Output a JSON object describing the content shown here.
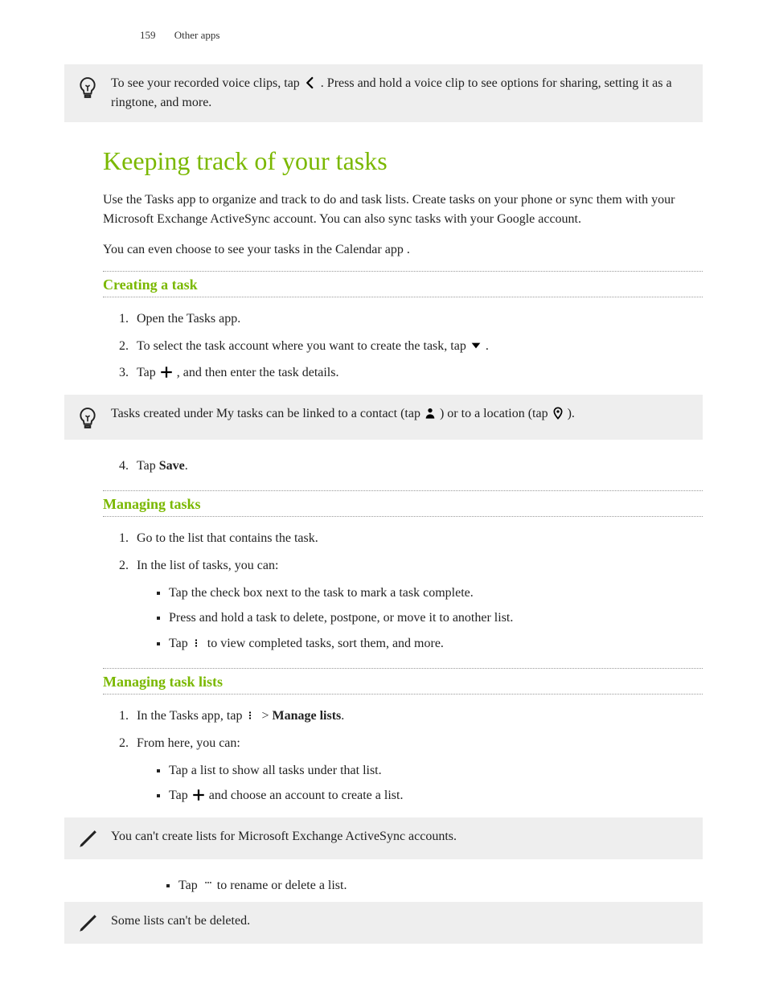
{
  "header": {
    "page_number": "159",
    "section": "Other apps"
  },
  "tip1": {
    "pre": "To see your recorded voice clips, tap ",
    "post": " . Press and hold a voice clip to see options for sharing, setting it as a ringtone, and more."
  },
  "main_heading": "Keeping track of your tasks",
  "intro_p1": "Use the Tasks app to organize and track to do and task lists. Create tasks on your phone or sync them with your Microsoft Exchange ActiveSync account. You can also sync tasks with your Google account.",
  "intro_p2": "You can even choose to see your tasks in the Calendar app .",
  "section_creating": {
    "heading": "Creating a task",
    "steps": {
      "s1": "Open the Tasks app.",
      "s2_pre": "To select the task account where you want to create the task, tap ",
      "s2_post": " .",
      "s3_pre": "Tap ",
      "s3_post": ", and then enter the task details.",
      "s4_pre": "Tap ",
      "s4_bold": "Save",
      "s4_post": "."
    },
    "tip": {
      "pre": "Tasks created under My tasks can be linked to a contact (tap ",
      "mid": " ) or to a location (tap ",
      "post": " )."
    }
  },
  "section_managing": {
    "heading": "Managing tasks",
    "steps": {
      "s1": "Go to the list that contains the task.",
      "s2": "In the list of tasks, you can:"
    },
    "bullets": {
      "b1": "Tap the check box next to the task to mark a task complete.",
      "b2": "Press and hold a task to delete, postpone, or move it to another list.",
      "b3_pre": "Tap ",
      "b3_post": " to view completed tasks, sort them, and more."
    }
  },
  "section_lists": {
    "heading": "Managing task lists",
    "steps": {
      "s1_pre": "In the Tasks app, tap ",
      "s1_mid": " > ",
      "s1_bold": "Manage lists",
      "s1_post": ".",
      "s2": "From here, you can:"
    },
    "bullets": {
      "b1": "Tap a list to show all tasks under that list.",
      "b2_pre": "Tap ",
      "b2_post": " and choose an account to create a list.",
      "b3_pre": "Tap ",
      "b3_post": " to rename or delete a list."
    },
    "note1": "You can't create lists for Microsoft Exchange ActiveSync accounts.",
    "note2": "Some lists can't be deleted."
  },
  "icons": {
    "lightbulb": "lightbulb-icon",
    "pencil": "pencil-icon",
    "back": "back-icon",
    "dropdown": "dropdown-icon",
    "plus": "plus-icon",
    "person": "person-icon",
    "location": "location-icon",
    "menu_vert": "menu-vertical-icon",
    "more_horiz": "more-horizontal-icon"
  }
}
